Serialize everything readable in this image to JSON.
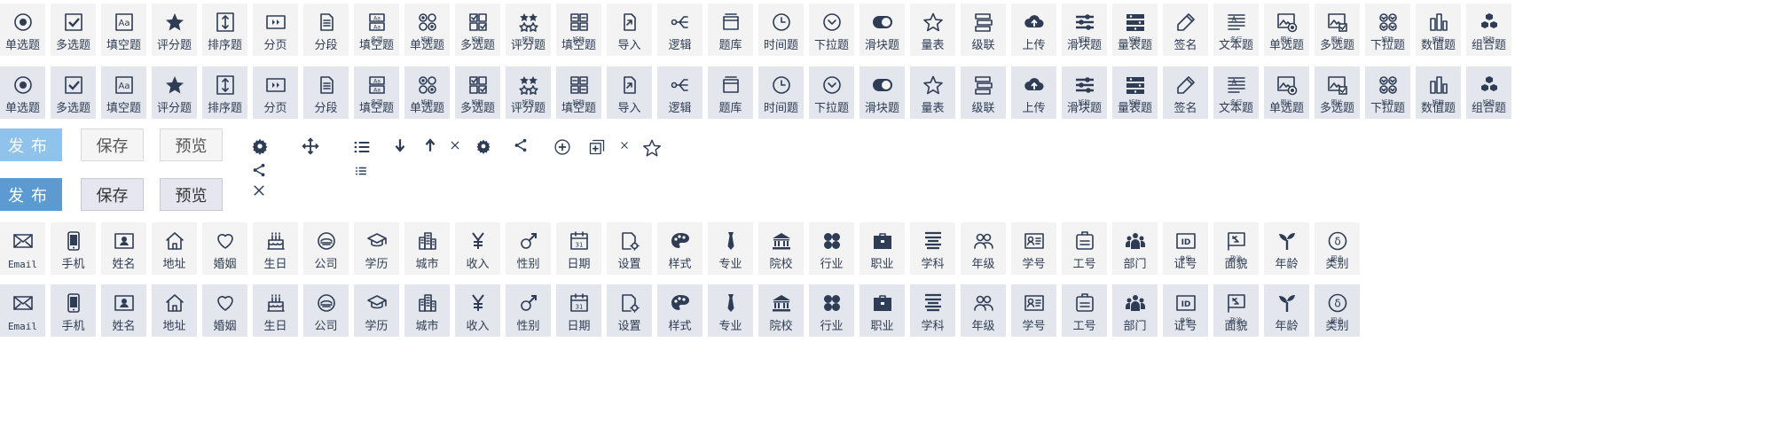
{
  "question_types": [
    {
      "label": "单选题",
      "sup": "",
      "icon": "radio"
    },
    {
      "label": "多选题",
      "sup": "",
      "icon": "checkbox"
    },
    {
      "label": "填空题",
      "sup": "",
      "icon": "text-aa"
    },
    {
      "label": "评分题",
      "sup": "",
      "icon": "star-solid"
    },
    {
      "label": "排序题",
      "sup": "",
      "icon": "sort"
    },
    {
      "label": "分页",
      "sup": "",
      "icon": "page-break"
    },
    {
      "label": "分段",
      "sup": "",
      "icon": "paragraph"
    },
    {
      "label": "填空题",
      "sup": "多项",
      "icon": "multi-fill"
    },
    {
      "label": "单选题",
      "sup": "矩阵",
      "icon": "matrix-radio"
    },
    {
      "label": "多选题",
      "sup": "矩阵",
      "icon": "matrix-checkbox"
    },
    {
      "label": "评分题",
      "sup": "矩阵",
      "icon": "matrix-stars"
    },
    {
      "label": "填空题",
      "sup": "矩阵",
      "icon": "matrix-fill"
    },
    {
      "label": "导入",
      "sup": "",
      "icon": "import"
    },
    {
      "label": "逻辑",
      "sup": "",
      "icon": "logic"
    },
    {
      "label": "题库",
      "sup": "",
      "icon": "library"
    },
    {
      "label": "时间题",
      "sup": "",
      "icon": "clock"
    },
    {
      "label": "下拉题",
      "sup": "",
      "icon": "dropdown"
    },
    {
      "label": "滑块题",
      "sup": "",
      "icon": "toggle"
    },
    {
      "label": "量表",
      "sup": "",
      "icon": "star-outline"
    },
    {
      "label": "级联",
      "sup": "",
      "icon": "cascade"
    },
    {
      "label": "上传",
      "sup": "",
      "icon": "upload"
    },
    {
      "label": "滑块题",
      "sup": "矩阵",
      "icon": "sliders"
    },
    {
      "label": "量表题",
      "sup": "矩阵",
      "icon": "matrix-scale"
    },
    {
      "label": "签名",
      "sup": "",
      "icon": "pen"
    },
    {
      "label": "文本题",
      "sup": "多行",
      "icon": "multiline"
    },
    {
      "label": "单选题",
      "sup": "图片",
      "icon": "image-radio"
    },
    {
      "label": "多选题",
      "sup": "图片",
      "icon": "image-checkbox"
    },
    {
      "label": "下拉题",
      "sup": "矩阵",
      "icon": "matrix-dropdown"
    },
    {
      "label": "数值题",
      "sup": "矩阵",
      "icon": "matrix-number"
    },
    {
      "label": "组合题",
      "sup": "矩阵",
      "icon": "cubes"
    }
  ],
  "buttons": {
    "row1": [
      {
        "label": "发布",
        "kind": "primary"
      },
      {
        "label": "保存",
        "kind": "sec"
      },
      {
        "label": "预览",
        "kind": "sec"
      }
    ],
    "row2": [
      {
        "label": "发布",
        "kind": "primary"
      },
      {
        "label": "保存",
        "kind": "sec"
      },
      {
        "label": "预览",
        "kind": "sec"
      }
    ]
  },
  "small_icons": [
    {
      "name": "gear-icon",
      "icon": "gear"
    },
    {
      "name": "share-icon",
      "icon": "share"
    },
    {
      "name": "close-icon",
      "icon": "close-x"
    },
    {
      "name": "move-icon",
      "icon": "move"
    },
    {
      "name": "list-icon",
      "icon": "list"
    },
    {
      "name": "list-small-icon",
      "icon": "list"
    },
    {
      "name": "arrow-down-icon",
      "icon": "arrow-down"
    },
    {
      "name": "arrow-up-icon",
      "icon": "arrow-up"
    },
    {
      "name": "close-small-icon",
      "icon": "close-x"
    },
    {
      "name": "gear-small-icon",
      "icon": "gear"
    },
    {
      "name": "share-small-icon",
      "icon": "share"
    },
    {
      "name": "add-circle-icon",
      "icon": "plus-circle"
    },
    {
      "name": "add-box-icon",
      "icon": "plus-square"
    },
    {
      "name": "close-tiny-icon",
      "icon": "close-x"
    },
    {
      "name": "star-outline-icon",
      "icon": "star-outline"
    }
  ],
  "personal_fields": [
    {
      "label": "Email",
      "sup": "",
      "icon": "mail"
    },
    {
      "label": "手机",
      "sup": "",
      "icon": "phone"
    },
    {
      "label": "姓名",
      "sup": "",
      "icon": "id-card"
    },
    {
      "label": "地址",
      "sup": "",
      "icon": "home"
    },
    {
      "label": "婚姻",
      "sup": "",
      "icon": "heart"
    },
    {
      "label": "生日",
      "sup": "",
      "icon": "cake"
    },
    {
      "label": "公司",
      "sup": "",
      "icon": "company"
    },
    {
      "label": "学历",
      "sup": "",
      "icon": "graduation"
    },
    {
      "label": "城市",
      "sup": "",
      "icon": "city"
    },
    {
      "label": "收入",
      "sup": "",
      "icon": "yen"
    },
    {
      "label": "性别",
      "sup": "",
      "icon": "gender"
    },
    {
      "label": "日期",
      "sup": "",
      "icon": "calendar"
    },
    {
      "label": "设置",
      "sup": "",
      "icon": "settings-doc"
    },
    {
      "label": "样式",
      "sup": "",
      "icon": "palette"
    },
    {
      "label": "专业",
      "sup": "",
      "icon": "tie"
    },
    {
      "label": "院校",
      "sup": "",
      "icon": "bank"
    },
    {
      "label": "行业",
      "sup": "",
      "icon": "clover"
    },
    {
      "label": "职业",
      "sup": "",
      "icon": "briefcase"
    },
    {
      "label": "学科",
      "sup": "",
      "icon": "subject"
    },
    {
      "label": "年级",
      "sup": "",
      "icon": "users"
    },
    {
      "label": "学号",
      "sup": "",
      "icon": "student-card"
    },
    {
      "label": "工号",
      "sup": "",
      "icon": "badge"
    },
    {
      "label": "部门",
      "sup": "",
      "icon": "team"
    },
    {
      "label": "证号",
      "sup": "身份",
      "icon": "id-text"
    },
    {
      "label": "面貌",
      "sup": "政治",
      "icon": "flag"
    },
    {
      "label": "年龄",
      "sup": "",
      "icon": "sprout"
    },
    {
      "label": "类别",
      "sup": "职业",
      "icon": "category"
    }
  ],
  "colors": {
    "icon": "#2e3c55",
    "tile": "#f3f3f3",
    "tile_alt": "#e3e6ec",
    "primary_light": "#8fc3ec",
    "primary": "#5b9bd1"
  }
}
